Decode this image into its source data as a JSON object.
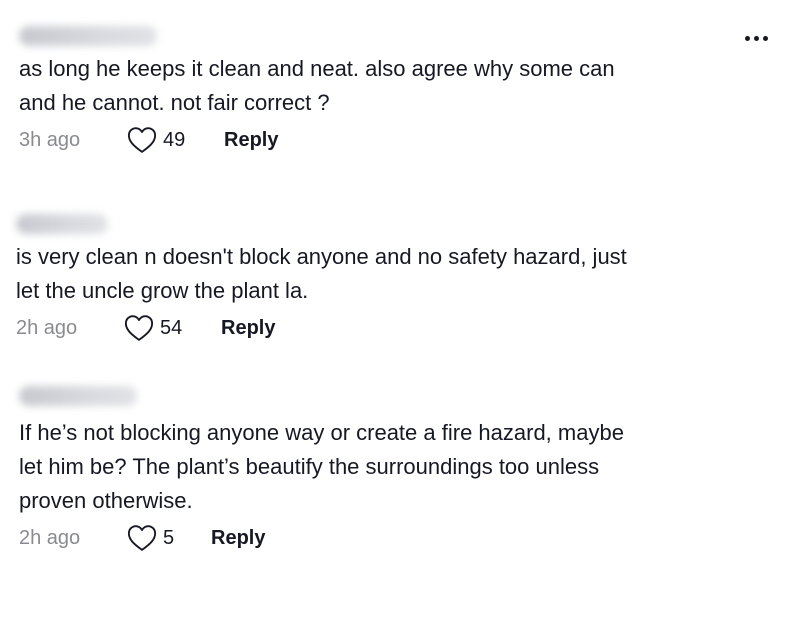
{
  "more_icon": "more-horizontal-icon",
  "comments": [
    {
      "username": "",
      "text_lines": [
        "as long he keeps it clean and neat. also agree why some can",
        "and he cannot. not fair correct ?"
      ],
      "time": "3h ago",
      "likes": "49",
      "reply_label": "Reply"
    },
    {
      "username": "",
      "text_lines": [
        "is very clean n doesn't block anyone and no safety hazard, just",
        "let the uncle grow the plant la."
      ],
      "time": "2h ago",
      "likes": "54",
      "reply_label": "Reply"
    },
    {
      "username": "",
      "text_lines": [
        "If he’s not blocking anyone way or create a fire hazard, maybe",
        "let him be? The plant’s beautify the surroundings too unless",
        "proven otherwise."
      ],
      "time": "2h ago",
      "likes": "5",
      "reply_label": "Reply"
    }
  ],
  "colors": {
    "text": "#161823",
    "secondary_text": "#8a8b91",
    "background": "#ffffff"
  }
}
